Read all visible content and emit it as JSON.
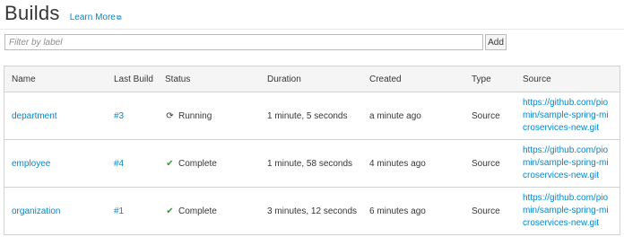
{
  "page": {
    "title": "Builds",
    "learn_more": "Learn More",
    "learn_more_icon": "external-link-icon"
  },
  "filter": {
    "placeholder": "Filter by label",
    "value": "",
    "add_label": "Add"
  },
  "table": {
    "headers": [
      "Name",
      "Last Build",
      "Status",
      "Duration",
      "Created",
      "Type",
      "Source"
    ],
    "rows": [
      {
        "name": "department",
        "last_build": "#3",
        "status": "Running",
        "status_icon": "refresh-icon",
        "duration": "1 minute, 5 seconds",
        "created": "a minute ago",
        "type": "Source",
        "source": "https://github.com/piomin/sample-spring-microservices-new.git"
      },
      {
        "name": "employee",
        "last_build": "#4",
        "status": "Complete",
        "status_icon": "checkmark-icon",
        "duration": "1 minute, 58 seconds",
        "created": "4 minutes ago",
        "type": "Source",
        "source": "https://github.com/piomin/sample-spring-microservices-new.git"
      },
      {
        "name": "organization",
        "last_build": "#1",
        "status": "Complete",
        "status_icon": "checkmark-icon",
        "duration": "3 minutes, 12 seconds",
        "created": "6 minutes ago",
        "type": "Source",
        "source": "https://github.com/piomin/sample-spring-microservices-new.git"
      }
    ]
  },
  "colors": {
    "link": "#0088ce",
    "success": "#3f9c35",
    "header_bg": "#f5f5f5",
    "border": "#d1d1d1"
  }
}
